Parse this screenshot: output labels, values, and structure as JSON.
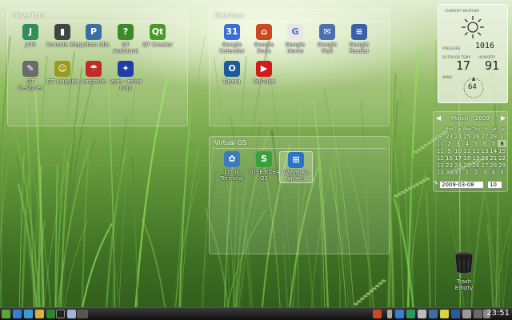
{
  "panels": {
    "havefun": {
      "title": "Have Fun!"
    },
    "webapps": {
      "title": "WebApps"
    },
    "virtual": {
      "title": "Virtual OS"
    }
  },
  "havefun_icons": [
    {
      "label": "JVM",
      "icon": "jvm-icon",
      "color": "#2f8f5a",
      "glyph": "J"
    },
    {
      "label": "konsole ide",
      "icon": "konsole-icon",
      "color": "#444444",
      "glyph": "▮"
    },
    {
      "label": "python idle",
      "icon": "python-icon",
      "color": "#3a6ea5",
      "glyph": "P"
    },
    {
      "label": "QT Assistant",
      "icon": "qt-assistant-icon",
      "color": "#3c8a2a",
      "glyph": "?"
    },
    {
      "label": "QT Creator",
      "icon": "qt-creator-icon",
      "color": "#4a9a2a",
      "glyph": "Qt"
    },
    {
      "label": "QT Designer",
      "icon": "qt-designer-icon",
      "color": "#6b6b6b",
      "glyph": "✎"
    },
    {
      "label": "QT Linguist",
      "icon": "qt-linguist-icon",
      "color": "#9a9a22",
      "glyph": "☺"
    },
    {
      "label": "umbrello",
      "icon": "umbrello-icon",
      "color": "#c02a2a",
      "glyph": "☂"
    },
    {
      "label": "vym - mind map",
      "icon": "vym-icon",
      "color": "#1e3fa8",
      "glyph": "✦"
    }
  ],
  "webapps_icons": [
    {
      "label": "Google Calendar",
      "icon": "calendar-app-icon",
      "color": "#3b6fd6",
      "glyph": "31"
    },
    {
      "label": "Google Docs",
      "icon": "docs-icon",
      "color": "#c94a1e",
      "glyph": "⌂"
    },
    {
      "label": "Google Home",
      "icon": "google-icon",
      "color": "#e7e7e7",
      "glyph": "G"
    },
    {
      "label": "Google Mail",
      "icon": "mail-icon",
      "color": "#4d6fb0",
      "glyph": "✉"
    },
    {
      "label": "Google Reader",
      "icon": "reader-icon",
      "color": "#3b5fa8",
      "glyph": "≡"
    },
    {
      "label": "Opera",
      "icon": "opera-icon",
      "color": "#1c5a9a",
      "glyph": "O"
    },
    {
      "label": "YouTube",
      "icon": "youtube-icon",
      "color": "#d11a1a",
      "glyph": "▶"
    }
  ],
  "virtual_icons": [
    {
      "label": "Linux Terminal",
      "icon": "terminal-icon",
      "color": "#3b7bbf",
      "glyph": "✿"
    },
    {
      "label": "SUSE KDE4 OS",
      "icon": "suse-icon",
      "color": "#3aa03a",
      "glyph": "S"
    },
    {
      "label": "Windows XP Pro",
      "icon": "windows-icon",
      "color": "#2a74c8",
      "glyph": "⊞"
    }
  ],
  "weather": {
    "title": "CURRENT WEATHER",
    "pressure_label": "PRESSURE",
    "pressure": "1016",
    "outdoor_label": "OUTDOOR TEMP",
    "humidity_label": "HUMIDITY",
    "temp": "17",
    "humidity": "91",
    "wind_label": "WIND",
    "wind": "64"
  },
  "calendar": {
    "month": "March",
    "year": "2009",
    "headers": [
      "Mon",
      "Tue",
      "Wed",
      "Thu",
      "Fri",
      "Sat",
      "Sun"
    ],
    "weeks": [
      {
        "wk": "9",
        "days": [
          "23",
          "24",
          "25",
          "26",
          "27",
          "28",
          "1"
        ]
      },
      {
        "wk": "10",
        "days": [
          "2",
          "3",
          "4",
          "5",
          "6",
          "7",
          "8"
        ]
      },
      {
        "wk": "11",
        "days": [
          "9",
          "10",
          "11",
          "12",
          "13",
          "14",
          "15"
        ]
      },
      {
        "wk": "12",
        "days": [
          "16",
          "17",
          "18",
          "19",
          "20",
          "21",
          "22"
        ]
      },
      {
        "wk": "13",
        "days": [
          "23",
          "24",
          "25",
          "26",
          "27",
          "28",
          "29"
        ]
      },
      {
        "wk": "14",
        "days": [
          "30",
          "31",
          "1",
          "2",
          "3",
          "4",
          "5"
        ]
      }
    ],
    "today": "8",
    "date": "2009-03-08",
    "week": "10"
  },
  "trash": {
    "label": "Trash Empty"
  },
  "taskbar": {
    "clock": "23:51"
  },
  "colors": {
    "panel_border": "#ffffff",
    "taskbar": "#1a1a1a",
    "grass_light": "#c5d9a7",
    "grass_dark": "#2e5a1a"
  }
}
